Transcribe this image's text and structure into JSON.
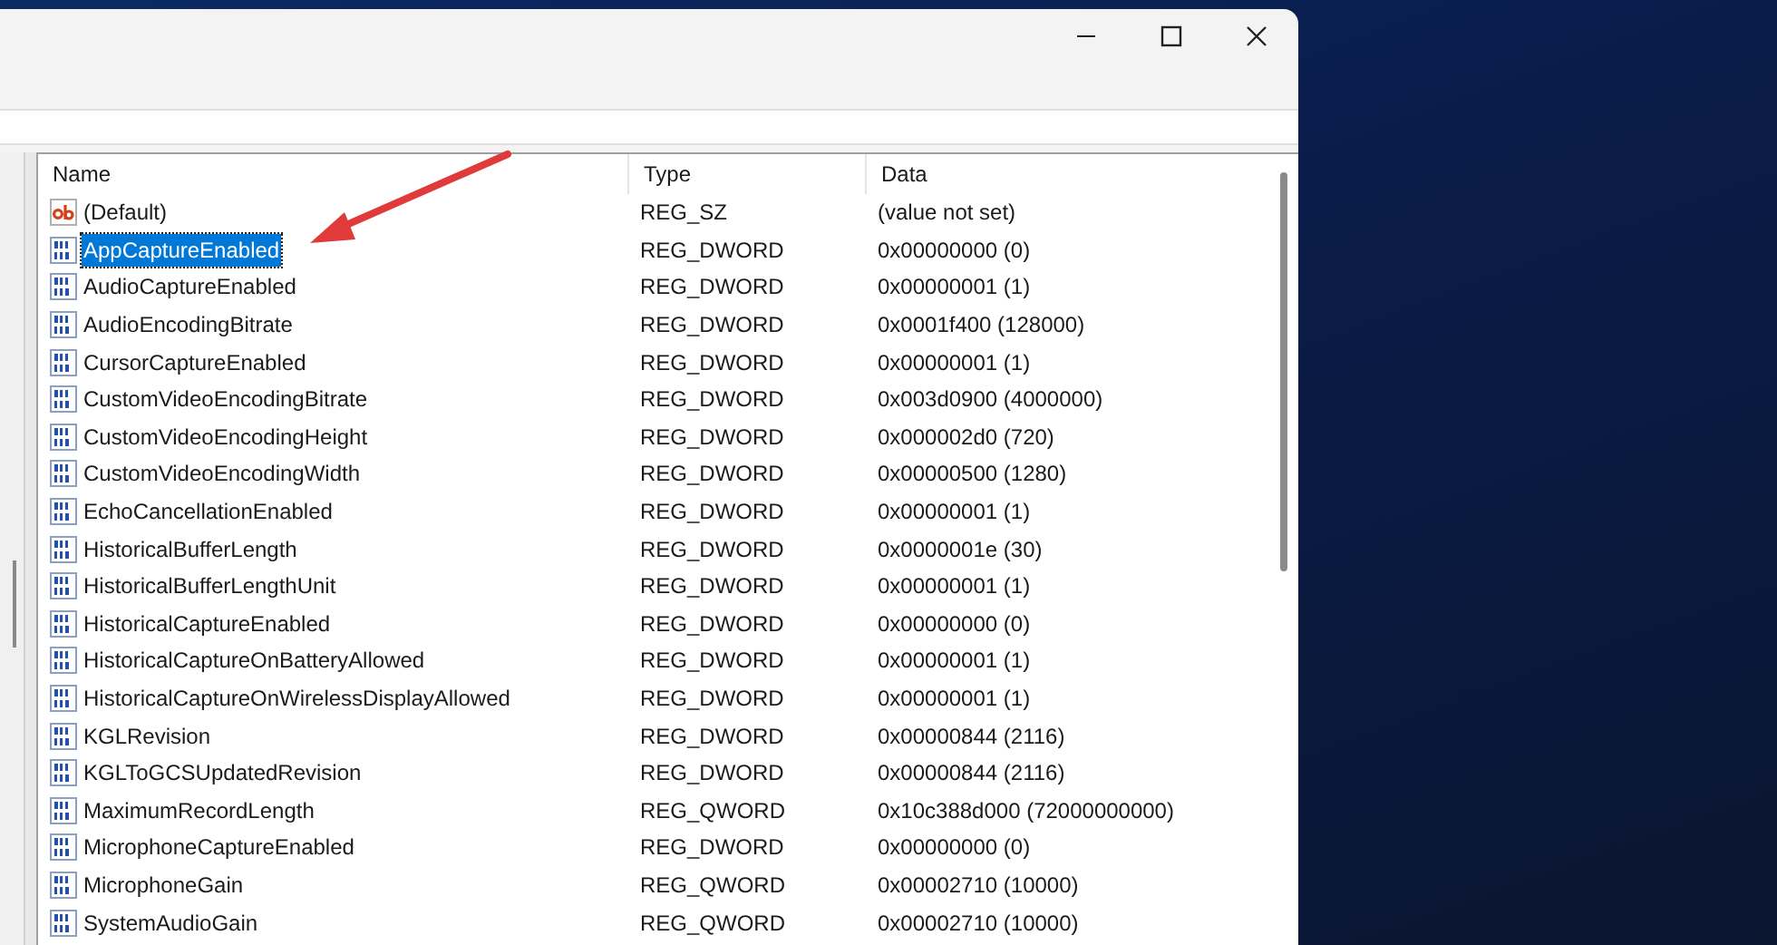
{
  "window": {
    "controls": [
      {
        "kind": "minimize"
      },
      {
        "kind": "maximize"
      },
      {
        "kind": "close"
      }
    ]
  },
  "table": {
    "columns": [
      "Name",
      "Type",
      "Data"
    ],
    "rows": [
      {
        "kind": "string",
        "name": "(Default)",
        "type": "REG_SZ",
        "data": "(value not set)",
        "selected": false
      },
      {
        "kind": "binary",
        "name": "AppCaptureEnabled",
        "type": "REG_DWORD",
        "data": "0x00000000 (0)",
        "selected": true
      },
      {
        "kind": "binary",
        "name": "AudioCaptureEnabled",
        "type": "REG_DWORD",
        "data": "0x00000001 (1)",
        "selected": false
      },
      {
        "kind": "binary",
        "name": "AudioEncodingBitrate",
        "type": "REG_DWORD",
        "data": "0x0001f400 (128000)",
        "selected": false
      },
      {
        "kind": "binary",
        "name": "CursorCaptureEnabled",
        "type": "REG_DWORD",
        "data": "0x00000001 (1)",
        "selected": false
      },
      {
        "kind": "binary",
        "name": "CustomVideoEncodingBitrate",
        "type": "REG_DWORD",
        "data": "0x003d0900 (4000000)",
        "selected": false
      },
      {
        "kind": "binary",
        "name": "CustomVideoEncodingHeight",
        "type": "REG_DWORD",
        "data": "0x000002d0 (720)",
        "selected": false
      },
      {
        "kind": "binary",
        "name": "CustomVideoEncodingWidth",
        "type": "REG_DWORD",
        "data": "0x00000500 (1280)",
        "selected": false
      },
      {
        "kind": "binary",
        "name": "EchoCancellationEnabled",
        "type": "REG_DWORD",
        "data": "0x00000001 (1)",
        "selected": false
      },
      {
        "kind": "binary",
        "name": "HistoricalBufferLength",
        "type": "REG_DWORD",
        "data": "0x0000001e (30)",
        "selected": false
      },
      {
        "kind": "binary",
        "name": "HistoricalBufferLengthUnit",
        "type": "REG_DWORD",
        "data": "0x00000001 (1)",
        "selected": false
      },
      {
        "kind": "binary",
        "name": "HistoricalCaptureEnabled",
        "type": "REG_DWORD",
        "data": "0x00000000 (0)",
        "selected": false
      },
      {
        "kind": "binary",
        "name": "HistoricalCaptureOnBatteryAllowed",
        "type": "REG_DWORD",
        "data": "0x00000001 (1)",
        "selected": false
      },
      {
        "kind": "binary",
        "name": "HistoricalCaptureOnWirelessDisplayAllowed",
        "type": "REG_DWORD",
        "data": "0x00000001 (1)",
        "selected": false
      },
      {
        "kind": "binary",
        "name": "KGLRevision",
        "type": "REG_DWORD",
        "data": "0x00000844 (2116)",
        "selected": false
      },
      {
        "kind": "binary",
        "name": "KGLToGCSUpdatedRevision",
        "type": "REG_DWORD",
        "data": "0x00000844 (2116)",
        "selected": false
      },
      {
        "kind": "binary",
        "name": "MaximumRecordLength",
        "type": "REG_QWORD",
        "data": "0x10c388d000 (72000000000)",
        "selected": false
      },
      {
        "kind": "binary",
        "name": "MicrophoneCaptureEnabled",
        "type": "REG_DWORD",
        "data": "0x00000000 (0)",
        "selected": false
      },
      {
        "kind": "binary",
        "name": "MicrophoneGain",
        "type": "REG_QWORD",
        "data": "0x00002710 (10000)",
        "selected": false
      },
      {
        "kind": "binary",
        "name": "SystemAudioGain",
        "type": "REG_QWORD",
        "data": "0x00002710 (10000)",
        "selected": false
      }
    ]
  }
}
